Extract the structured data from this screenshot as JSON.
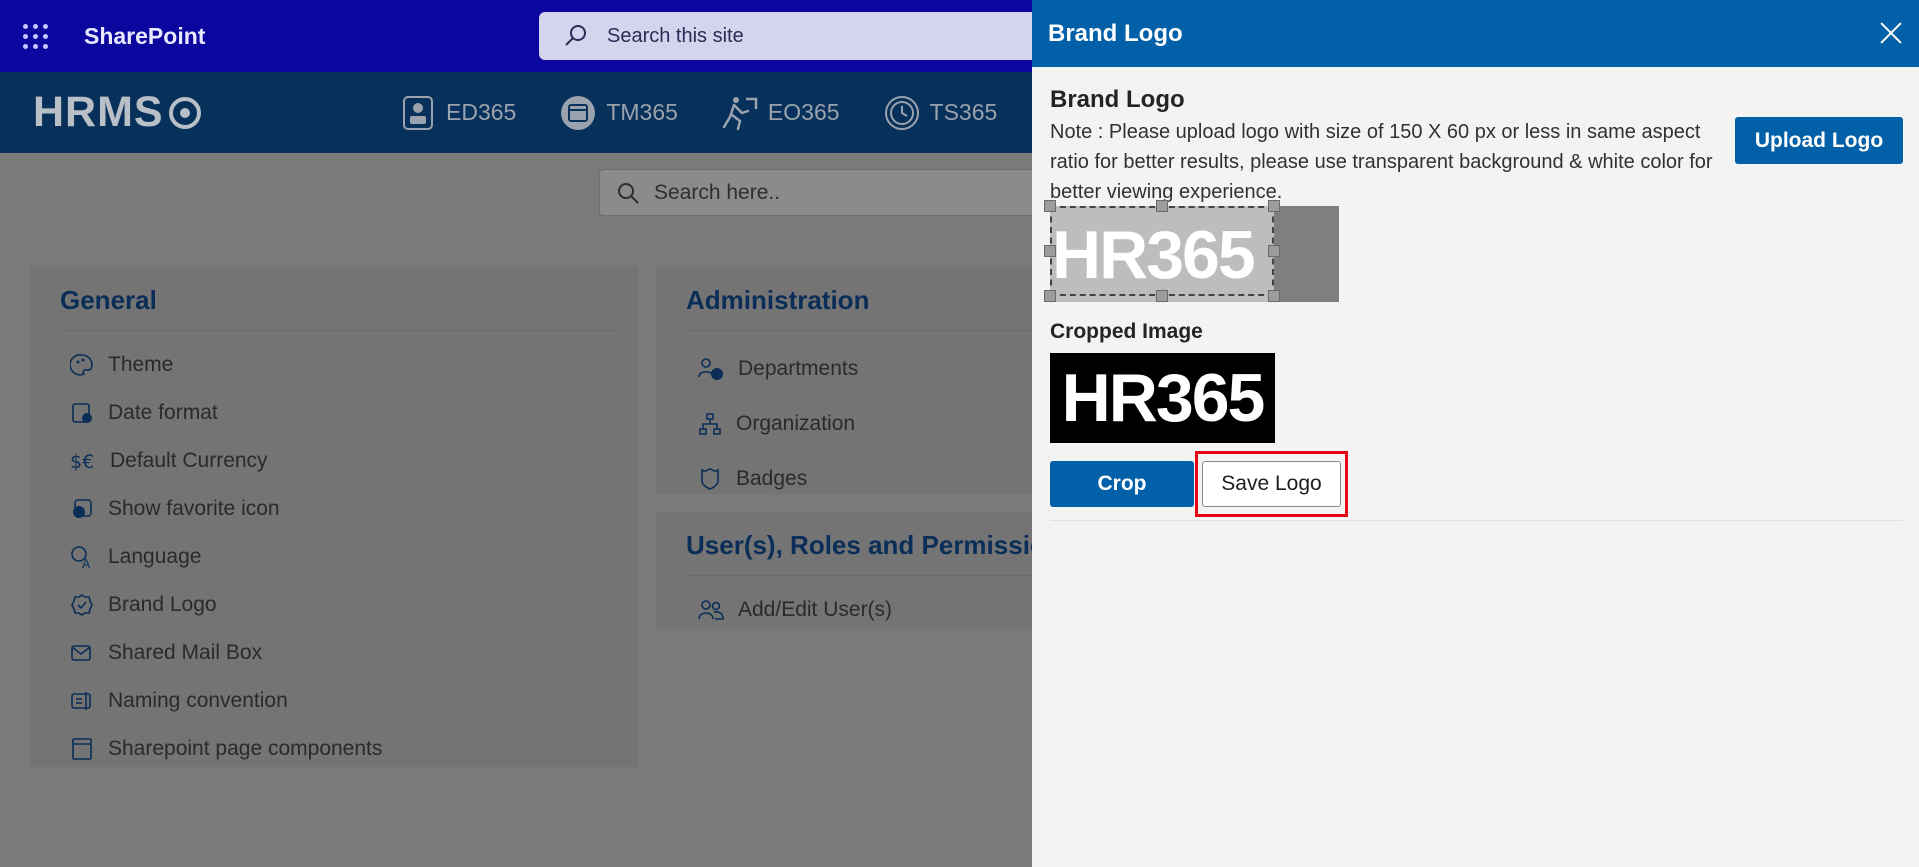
{
  "suitebar": {
    "app_name": "SharePoint",
    "search_placeholder": "Search this site"
  },
  "header": {
    "logo_text": "HRMS",
    "tabs": [
      {
        "label": "ED365",
        "icon": "employee-directory-icon"
      },
      {
        "label": "TM365",
        "icon": "calendar-icon"
      },
      {
        "label": "EO365",
        "icon": "exit-icon"
      },
      {
        "label": "TS365",
        "icon": "clock-icon"
      }
    ]
  },
  "page": {
    "search_placeholder": "Search here..",
    "general": {
      "title": "General",
      "items": [
        {
          "label": "Theme",
          "icon": "palette-icon"
        },
        {
          "label": "Date format",
          "icon": "calendar-clock-icon"
        },
        {
          "label": "Default Currency",
          "icon": "currency-icon"
        },
        {
          "label": "Show favorite icon",
          "icon": "favorite-icon"
        },
        {
          "label": "Language",
          "icon": "language-icon"
        },
        {
          "label": "Brand Logo",
          "icon": "badge-icon"
        },
        {
          "label": "Shared Mail Box",
          "icon": "mailbox-icon"
        },
        {
          "label": "Naming convention",
          "icon": "rename-icon"
        },
        {
          "label": "Sharepoint page components",
          "icon": "page-icon"
        }
      ]
    },
    "administration": {
      "title": "Administration",
      "items": [
        {
          "label": "Departments",
          "icon": "departments-icon"
        },
        {
          "label": "Organization",
          "icon": "org-chart-icon"
        },
        {
          "label": "Badges",
          "icon": "badge-shield-icon"
        }
      ]
    },
    "users": {
      "title": "User(s), Roles and Permissio",
      "items": [
        {
          "label": "Add/Edit User(s)",
          "icon": "users-icon"
        }
      ]
    }
  },
  "panel": {
    "header_title": "Brand Logo",
    "section_title": "Brand Logo",
    "note": "Note : Please upload logo with size of 150 X 60 px or less in same aspect ratio for better results, please use transparent background & white color for better viewing experience.",
    "upload_label": "Upload Logo",
    "source_image_text": "HR365",
    "cropped_label": "Cropped Image",
    "cropped_image_text": "HR365",
    "crop_label": "Crop",
    "save_label": "Save Logo"
  },
  "colors": {
    "suitebar": "#0b079e",
    "app_header": "#07305a",
    "panel_header": "#0160a8",
    "primary_button": "#0160a8",
    "highlight": "#e40613"
  }
}
